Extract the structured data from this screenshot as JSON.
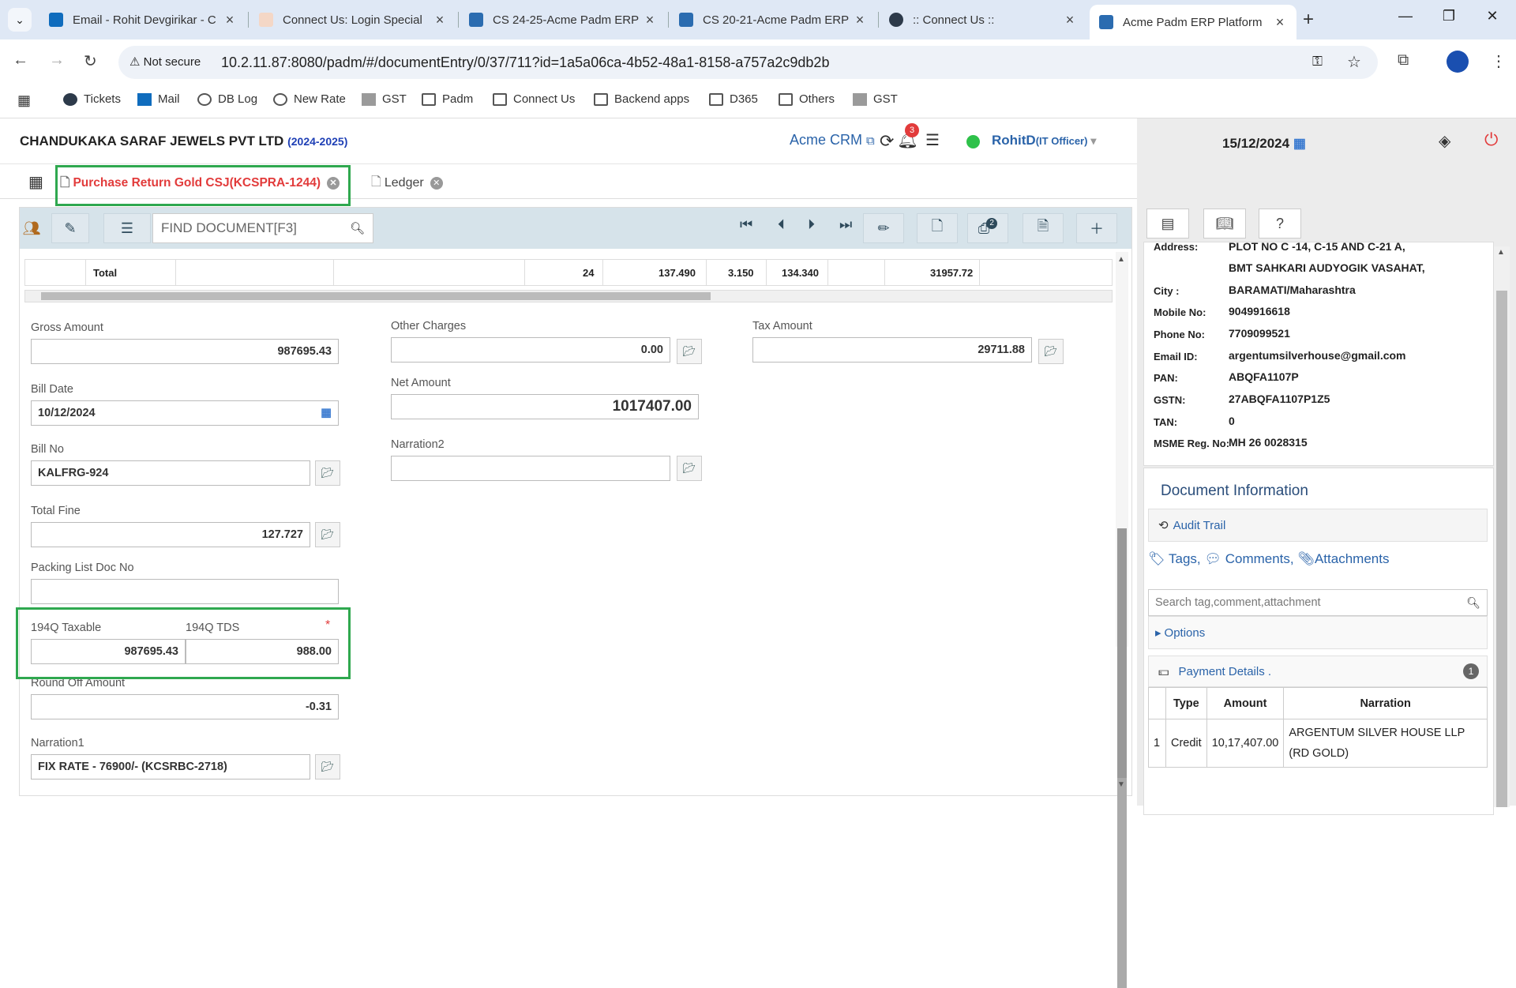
{
  "browser": {
    "tabs": [
      {
        "title": "Email - Rohit Devgirikar - C"
      },
      {
        "title": "Connect Us: Login Special"
      },
      {
        "title": "CS 24-25-Acme Padm ERP"
      },
      {
        "title": "CS 20-21-Acme Padm ERP"
      },
      {
        "title": ":: Connect Us ::"
      },
      {
        "title": "Acme Padm ERP Platform"
      }
    ],
    "security": "Not secure",
    "url": "10.2.11.87:8080/padm/#/documentEntry/0/37/711?id=1a5a06ca-4b52-48a1-8158-a757a2c9db2b",
    "bookmarks": [
      "Tickets",
      "Mail",
      "DB Log",
      "New Rate",
      "GST",
      "Padm",
      "Connect Us",
      "Backend apps",
      "D365",
      "Others",
      "GST"
    ]
  },
  "header": {
    "company": "CHANDUKAKA SARAF JEWELS PVT LTD",
    "year": "(2024-2025)",
    "crm": "Acme CRM",
    "notif_count": "3",
    "user": "RohitD",
    "role": "(IT Officer)",
    "date": "15/12/2024"
  },
  "doc_tabs": [
    {
      "label": "Purchase Return Gold CSJ(KCSPRA-1244)"
    },
    {
      "label": "Ledger"
    }
  ],
  "toolbar": {
    "find_placeholder": "FIND DOCUMENT[F3]",
    "badge_print": "2"
  },
  "grid_total": {
    "label": "Total",
    "c1": "24",
    "c2": "137.490",
    "c3": "3.150",
    "c4": "134.340",
    "c5": "31957.72"
  },
  "form": {
    "gross_amount": {
      "label": "Gross Amount",
      "value": "987695.43"
    },
    "bill_date": {
      "label": "Bill Date",
      "value": "10/12/2024"
    },
    "bill_no": {
      "label": "Bill No",
      "value": "KALFRG-924"
    },
    "total_fine": {
      "label": "Total Fine",
      "value": "127.727"
    },
    "packing_list": {
      "label": "Packing List Doc No",
      "value": ""
    },
    "taxable_194q": {
      "label": "194Q Taxable",
      "value": "987695.43"
    },
    "tds_194q": {
      "label": "194Q TDS",
      "value": "988.00",
      "required": "*"
    },
    "round_off": {
      "label": "Round Off Amount",
      "value": "-0.31"
    },
    "narration1": {
      "label": "Narration1",
      "value": "FIX RATE - 76900/-  (KCSRBC-2718)"
    },
    "other_charges": {
      "label": "Other Charges",
      "value": "0.00"
    },
    "net_amount": {
      "label": "Net Amount",
      "value": "1017407.00"
    },
    "narration2": {
      "label": "Narration2",
      "value": ""
    },
    "tax_amount": {
      "label": "Tax Amount",
      "value": "29711.88"
    }
  },
  "vendor": {
    "address_label": "Address:",
    "address1": "PLOT NO C -14, C-15 AND C-21 A,",
    "address2": "BMT SAHKARI AUDYOGIK VASAHAT,",
    "city_label": "City :",
    "city": "BARAMATI/Maharashtra",
    "mobile_label": "Mobile No:",
    "mobile": "9049916618",
    "phone_label": "Phone No:",
    "phone": "7709099521",
    "email_label": "Email ID:",
    "email": "argentumsilverhouse@gmail.com",
    "pan_label": "PAN:",
    "pan": "ABQFA1107P",
    "gstn_label": "GSTN:",
    "gstn": "27ABQFA1107P1Z5",
    "tan_label": "TAN:",
    "tan": "0",
    "msme_label": "MSME Reg. No:",
    "msme": "MH 26 0028315"
  },
  "doc_info": {
    "title": "Document Information",
    "audit": "Audit Trail",
    "tags": "Tags,",
    "comments": "Comments,",
    "attachments": "Attachments",
    "search_placeholder": "Search tag,comment,attachment",
    "options": "Options",
    "payment_details": "Payment Details .",
    "payment_count": "1"
  },
  "payment_table": {
    "headers": [
      "Type",
      "Amount",
      "Narration"
    ],
    "rows": [
      {
        "no": "1",
        "type": "Credit",
        "amount": "10,17,407.00",
        "narration": "ARGENTUM SILVER HOUSE LLP (RD GOLD)"
      }
    ]
  },
  "colors": {
    "accent": "#2a63a9",
    "tab_red": "#e23b3b",
    "highlight": "#2fa84f"
  }
}
